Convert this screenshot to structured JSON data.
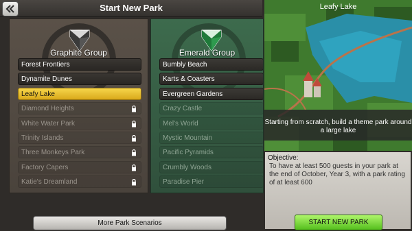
{
  "header": {
    "title": "Start New Park"
  },
  "groups": [
    {
      "name": "Graphite Group",
      "items": [
        {
          "label": "Forest Frontiers",
          "state": "active"
        },
        {
          "label": "Dynamite Dunes",
          "state": "active"
        },
        {
          "label": "Leafy Lake",
          "state": "selected"
        },
        {
          "label": "Diamond Heights",
          "state": "locked"
        },
        {
          "label": "White Water Park",
          "state": "locked"
        },
        {
          "label": "Trinity Islands",
          "state": "locked"
        },
        {
          "label": "Three Monkeys Park",
          "state": "locked"
        },
        {
          "label": "Factory Capers",
          "state": "locked"
        },
        {
          "label": "Katie's Dreamland",
          "state": "locked"
        }
      ]
    },
    {
      "name": "Emerald Group",
      "items": [
        {
          "label": "Bumbly Beach",
          "state": "active"
        },
        {
          "label": "Karts & Coasters",
          "state": "active"
        },
        {
          "label": "Evergreen Gardens",
          "state": "active"
        },
        {
          "label": "Crazy Castle",
          "state": "locked"
        },
        {
          "label": "Mel's World",
          "state": "locked"
        },
        {
          "label": "Mystic Mountain",
          "state": "locked"
        },
        {
          "label": "Pacific Pyramids",
          "state": "locked"
        },
        {
          "label": "Crumbly Woods",
          "state": "locked"
        },
        {
          "label": "Paradise Pier",
          "state": "locked"
        }
      ]
    }
  ],
  "preview": {
    "title": "Leafy Lake",
    "description": "Starting from scratch, build a theme park around a large lake"
  },
  "objective": {
    "label": "Objective:",
    "text": "To have at least 500 guests in your park at the end of October, Year 3, with a park rating of at least 600"
  },
  "buttons": {
    "more": "More Park Scenarios",
    "start": "START NEW PARK"
  },
  "colors": {
    "selected": "#f0c832",
    "start_button": "#7fdc3a",
    "emerald_panel": "#3d6b4d",
    "graphite_panel": "#5a5148"
  }
}
